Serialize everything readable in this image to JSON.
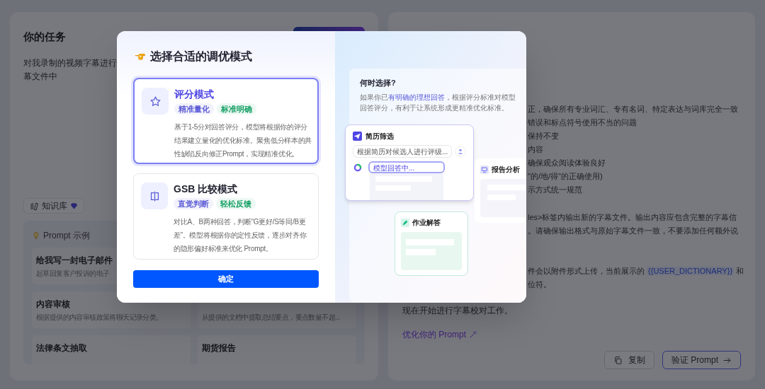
{
  "task_panel": {
    "title": "你的任务",
    "description_lines": [
      "对我录制的视频字幕进行",
      "幕文件中"
    ],
    "knowledge_chip": "知识库",
    "examples": {
      "title": "Prompt 示例",
      "columns": [
        [
          {
            "title": "给我写一封电子邮件",
            "subtitle": "起草回复客户投诉的电子"
          },
          {
            "title": "内容审核",
            "subtitle": "根据提供的内容审核政策将聊天记录分类。"
          },
          {
            "title": "法律条文抽取"
          }
        ],
        [
          {
            "subtitle": "从提供的文档中提取总结要点，要点数量不超..."
          },
          {
            "title": "期货报告"
          }
        ]
      ]
    }
  },
  "prompt_panel": {
    "paragraphs": [
      {
        "indent": true,
        "lines": [
          {
            "text": "正，确保所有专业词汇、专有名词、特定表达与词库完全一致"
          },
          {
            "text": "错误和标点符号使用不当的问题"
          },
          {
            "text": "保持不变"
          },
          {
            "text": "内容"
          },
          {
            "text": "确保观众阅读体验良好"
          },
          {
            "text": "\"的/地/得\"的正确使用)"
          },
          {
            "text": "示方式统一规范"
          }
        ]
      },
      {
        "indent": true,
        "lines": [
          {
            "text": "les>标签内输出新的字幕文件。输出内容应包含完整的字幕信"
          },
          {
            "text": "。请确保输出格式与原始字幕文件一致，不要添加任何额外说"
          }
        ]
      },
      {
        "indent": true,
        "lines": [
          {
            "before": "件会以附件形式上传，当前展示的",
            "variable": "{{USER_DICTIONARY}}",
            "after": "和"
          },
          {
            "text": "位符。"
          }
        ]
      },
      {
        "indent": false,
        "lines": [
          {
            "text": "现在开始进行字幕校对工作。"
          }
        ]
      }
    ],
    "optimize_link": "优化你的 Prompt",
    "buttons": [
      {
        "label": "复制",
        "kind": "copy"
      },
      {
        "label": "验证 Prompt",
        "kind": "verify"
      }
    ]
  },
  "modal": {
    "title": "选择合适的调优模式",
    "modes": [
      {
        "kind": "score",
        "name": "评分模式",
        "selected": true,
        "tags": [
          {
            "label": "精准量化",
            "color": "#5b5bd6"
          },
          {
            "label": "标准明确",
            "color": "#17a066"
          }
        ],
        "description": "基于1-5分对回答评分，模型将根据你的评分结果建立量化的优化标准。聚焦低分样本的共性缺陷反向修正Prompt，实现精准优化。"
      },
      {
        "kind": "compare",
        "name": "GSB 比较模式",
        "selected": false,
        "tags": [
          {
            "label": "直觉判断",
            "color": "#5b5bd6"
          },
          {
            "label": "轻松反馈",
            "color": "#17a066"
          }
        ],
        "description": "对比A、B两种回答，判断“G更好/S等同/B更差”。模型将根据你的定性反馈，逐步对齐你的隐形偏好标准来优化 Prompt。"
      }
    ],
    "confirm_button": "确定",
    "help": {
      "title": "何时选择?",
      "before": "如果你已",
      "highlight": "有明确的理想回答",
      "after": "，根据评分标准对模型回答评分，有利于让系统形成更精准优化标准。"
    },
    "illustration": {
      "resume_card": {
        "title": "简历筛选",
        "user_message": "根据简历对候选人进行评级...",
        "model_message": "模型回答中..."
      },
      "report_card": {
        "title": "报告分析"
      },
      "homework_card": {
        "title": "作业解答"
      }
    }
  }
}
